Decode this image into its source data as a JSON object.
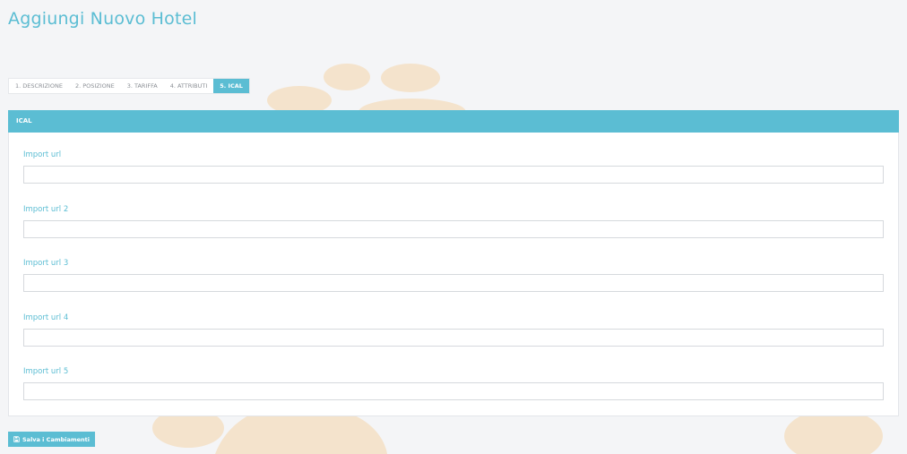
{
  "page": {
    "title": "Aggiungi Nuovo Hotel"
  },
  "tabs": [
    {
      "label": "1. DESCRIZIONE",
      "active": false
    },
    {
      "label": "2. POSIZIONE",
      "active": false
    },
    {
      "label": "3. TARIFFA",
      "active": false
    },
    {
      "label": "4. ATTRIBUTI",
      "active": false
    },
    {
      "label": "5. ICAL",
      "active": true
    }
  ],
  "panel": {
    "header": "ICAL",
    "fields": [
      {
        "label": "Import url",
        "value": ""
      },
      {
        "label": "Import url 2",
        "value": ""
      },
      {
        "label": "Import url 3",
        "value": ""
      },
      {
        "label": "Import url 4",
        "value": ""
      },
      {
        "label": "Import url 5",
        "value": ""
      }
    ]
  },
  "actions": {
    "save_label": "Salva i Cambiamenti",
    "save_icon": "floppy-disk-icon"
  },
  "colors": {
    "accent": "#5bbdd3",
    "background": "#f4f5f7",
    "decor": "#f4e3cc"
  }
}
